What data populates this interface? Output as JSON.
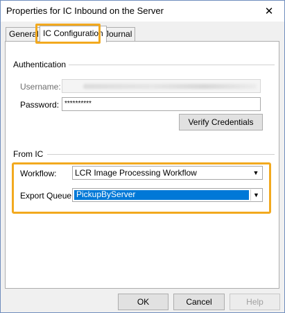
{
  "window": {
    "title": "Properties for IC Inbound on the Server"
  },
  "tabs": [
    {
      "label": "General"
    },
    {
      "label": "IC Configuration"
    },
    {
      "label": "Journal"
    }
  ],
  "authentication": {
    "group_label": "Authentication",
    "username_label": "Username:",
    "username_value": "",
    "password_label": "Password:",
    "password_value": "**********",
    "verify_button": "Verify Credentials"
  },
  "from_ic": {
    "group_label": "From IC",
    "workflow_label": "Workflow:",
    "workflow_value": "LCR Image Processing Workflow",
    "export_queue_label": "Export Queue:",
    "export_queue_value": "PickupByServer"
  },
  "buttons": {
    "ok": "OK",
    "cancel": "Cancel",
    "help": "Help"
  },
  "icons": {
    "close": "✕",
    "dropdown": "▼"
  },
  "colors": {
    "highlight": "#f2a91e",
    "selection": "#0078d7"
  }
}
